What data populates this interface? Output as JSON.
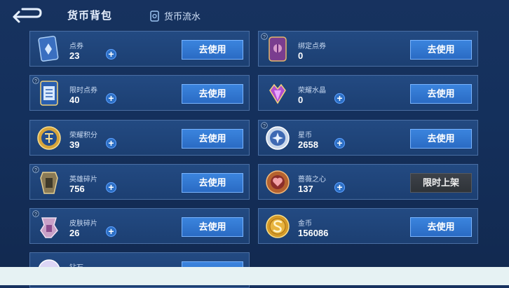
{
  "header": {
    "title": "货币背包",
    "flow_label": "货币流水"
  },
  "currencies": [
    {
      "name": "点券",
      "count": "23",
      "action": "去使用"
    },
    {
      "name": "绑定点券",
      "count": "0",
      "action": "去使用"
    },
    {
      "name": "限时点券",
      "count": "40",
      "action": "去使用"
    },
    {
      "name": "荣耀水晶",
      "count": "0",
      "action": "去使用"
    },
    {
      "name": "荣耀积分",
      "count": "39",
      "action": "去使用"
    },
    {
      "name": "星币",
      "count": "2658",
      "action": "去使用"
    },
    {
      "name": "英雄碎片",
      "count": "756",
      "action": "去使用"
    },
    {
      "name": "蔷薇之心",
      "count": "137",
      "action": "限时上架"
    },
    {
      "name": "皮肤碎片",
      "count": "26",
      "action": "去使用"
    },
    {
      "name": "金币",
      "count": "156086",
      "action": "去使用"
    },
    {
      "name": "钻石",
      "count": "",
      "action": ""
    }
  ],
  "icons": [
    "coupon-icon",
    "bound-coupon-icon",
    "limited-coupon-icon",
    "crystal-icon",
    "honor-points-icon",
    "star-coin-icon",
    "hero-shard-icon",
    "rose-heart-icon",
    "skin-shard-icon",
    "gold-coin-icon",
    "diamond-icon"
  ],
  "colors": {
    "background": "#17325f",
    "card": "#234a82",
    "button": "#3b84de",
    "disabled_button": "#3d4249"
  }
}
